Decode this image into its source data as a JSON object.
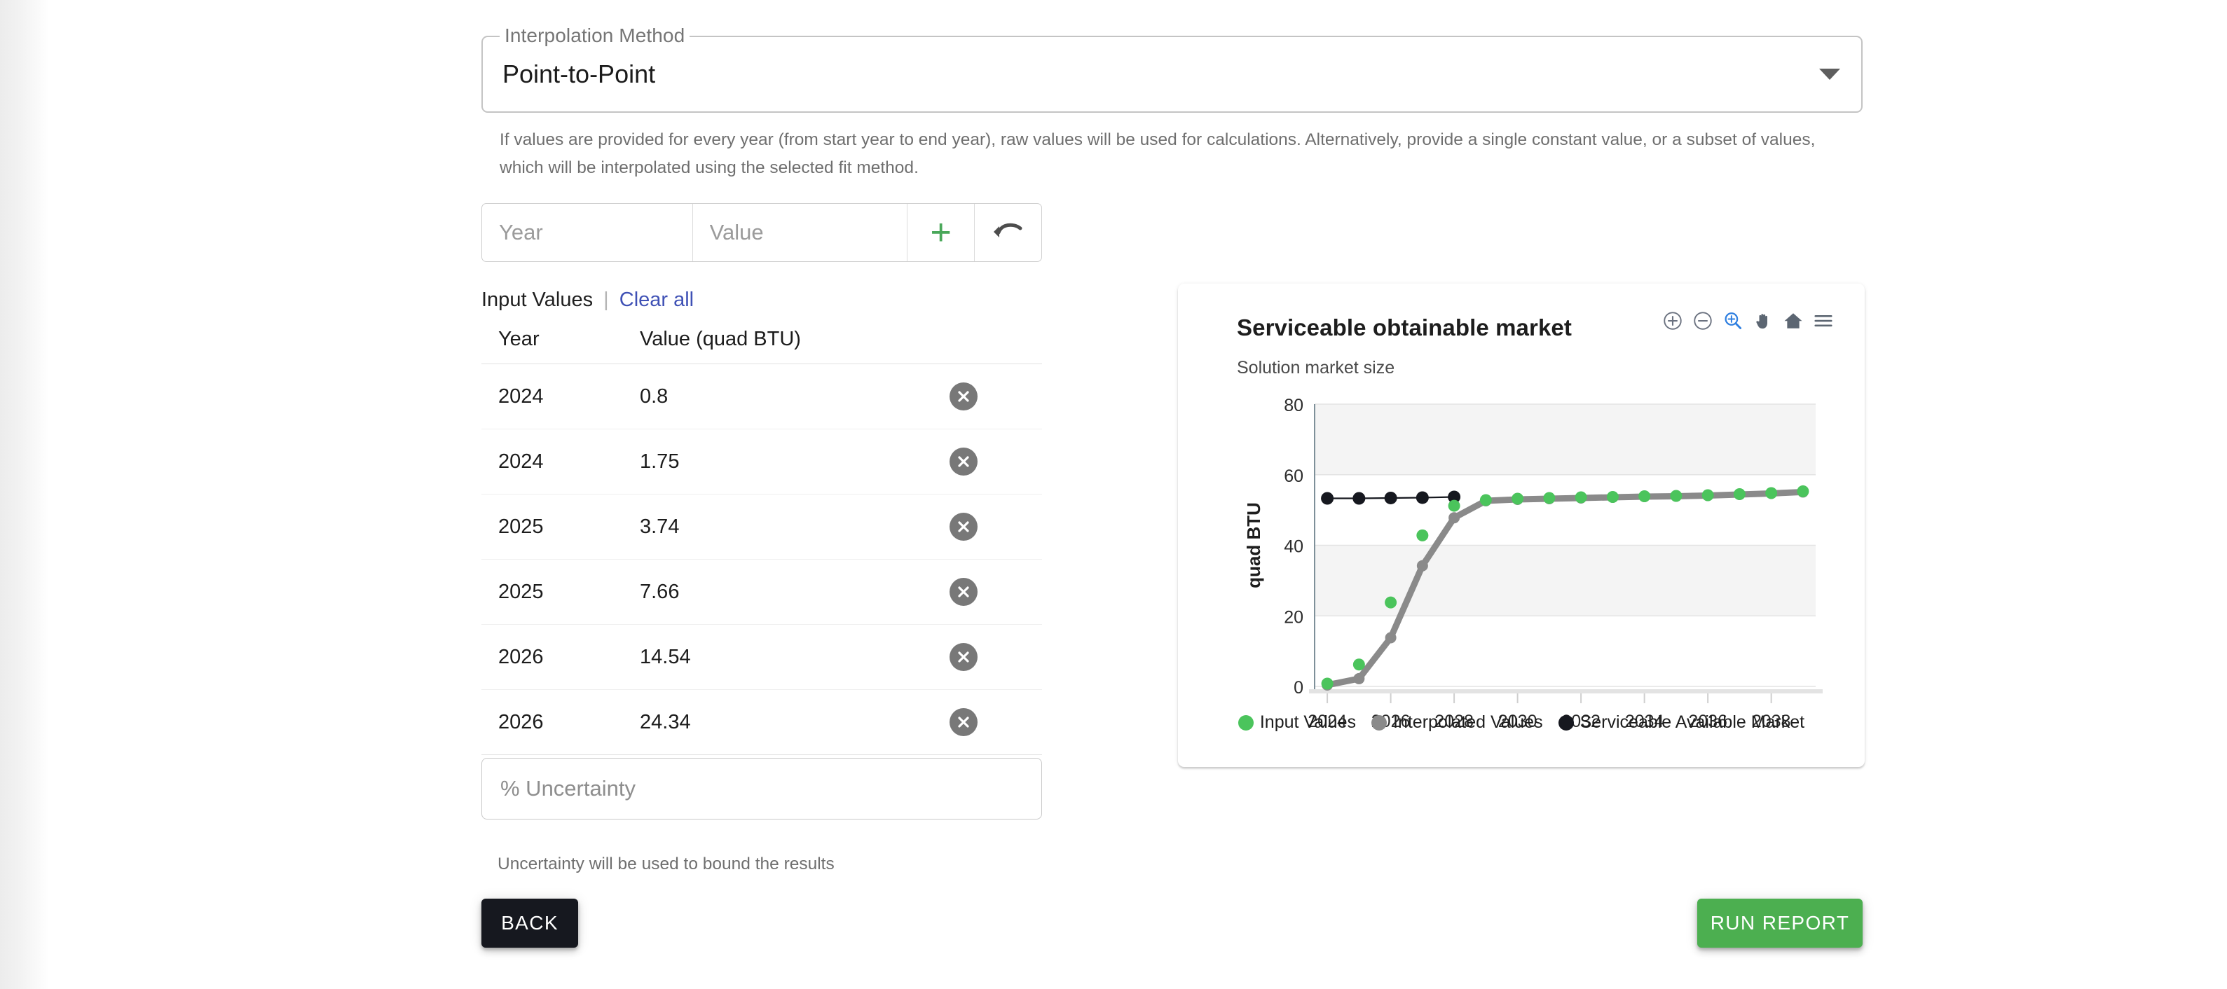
{
  "form": {
    "interpolation": {
      "legend": "Interpolation Method",
      "value": "Point-to-Point",
      "caret_icon": "chevron-down-icon"
    },
    "helper_text": "If values are provided for every year (from start year to end year), raw values will be used for calculations. Alternatively, provide a single constant value, or a subset of values, which will be interpolated using the selected fit method.",
    "adder": {
      "year_placeholder": "Year",
      "year_value": "",
      "value_placeholder": "Value",
      "value_value": "",
      "add_icon": "plus-icon",
      "undo_icon": "undo-arrow-icon"
    },
    "input_values_label": "Input Values",
    "separator": "|",
    "clear_all_label": "Clear all",
    "table": {
      "headers": [
        "Year",
        "Value (quad BTU)",
        ""
      ],
      "rows": [
        {
          "year": "2024",
          "value": "0.8",
          "delete_icon": "close-circle-icon"
        },
        {
          "year": "2024",
          "value": "1.75",
          "delete_icon": "close-circle-icon"
        },
        {
          "year": "2025",
          "value": "3.74",
          "delete_icon": "close-circle-icon"
        },
        {
          "year": "2025",
          "value": "7.66",
          "delete_icon": "close-circle-icon"
        },
        {
          "year": "2026",
          "value": "14.54",
          "delete_icon": "close-circle-icon"
        },
        {
          "year": "2026",
          "value": "24.34",
          "delete_icon": "close-circle-icon"
        }
      ]
    },
    "uncertainty": {
      "placeholder": "% Uncertainty",
      "value": "",
      "helper": "Uncertainty will be used to bound the results"
    }
  },
  "actions": {
    "back_label": "BACK",
    "run_report_label": "RUN REPORT"
  },
  "chart_card": {
    "toolbar": [
      {
        "icon": "zoom-in-icon",
        "active": false
      },
      {
        "icon": "zoom-out-icon",
        "active": false
      },
      {
        "icon": "selection-zoom-icon",
        "active": true
      },
      {
        "icon": "pan-hand-icon",
        "active": false
      },
      {
        "icon": "home-reset-icon",
        "active": false
      },
      {
        "icon": "menu-hamburger-icon",
        "active": false
      }
    ]
  },
  "colors": {
    "input_values": "#4bc45c",
    "interpolated_values": "#8a8a8a",
    "serviceable_available_market": "#16181f",
    "run_report": "#4caf50",
    "back": "#16181f",
    "link": "#3f51b5",
    "toolbar_active": "#2f7fe0"
  },
  "chart_data": {
    "type": "scatter",
    "title": "Serviceable obtainable market",
    "subtitle": "Solution market size",
    "xlabel": "",
    "ylabel": "quad BTU",
    "xlim": [
      2023.6,
      2039.4
    ],
    "ylim": [
      0,
      80
    ],
    "yticks": [
      0,
      20,
      40,
      60,
      80
    ],
    "xticks": [
      2024,
      2026,
      2028,
      2030,
      2032,
      2034,
      2036,
      2038
    ],
    "grid": true,
    "legend_position": "bottom",
    "legend": [
      "Input Values",
      "Interpolated Values",
      "Serviceable Available Market"
    ],
    "series": [
      {
        "name": "Input Values",
        "color": "#4bc45c",
        "x": [
          2024,
          2025,
          2026,
          2027,
          2028,
          2029,
          2030,
          2031,
          2032,
          2033,
          2034,
          2035,
          2036,
          2037,
          2038,
          2039
        ],
        "y": [
          0.8,
          6.2,
          23.8,
          42.8,
          51.2,
          52.8,
          53.2,
          53.4,
          53.6,
          53.7,
          53.9,
          54.0,
          54.2,
          54.5,
          54.8,
          55.3
        ]
      },
      {
        "name": "Interpolated Values",
        "color": "#8a8a8a",
        "x": [
          2024,
          2025,
          2026,
          2027,
          2028,
          2029,
          2030,
          2031,
          2032,
          2033,
          2034,
          2035,
          2036,
          2037,
          2038,
          2039
        ],
        "y": [
          0.4,
          2.2,
          13.8,
          34.2,
          47.8,
          52.6,
          53.0,
          53.2,
          53.4,
          53.6,
          53.8,
          53.9,
          54.1,
          54.4,
          54.7,
          55.1
        ]
      },
      {
        "name": "Serviceable Available Market",
        "color": "#16181f",
        "x": [
          2024,
          2025,
          2026,
          2027,
          2028
        ],
        "y": [
          53.3,
          53.3,
          53.4,
          53.5,
          53.7
        ]
      }
    ]
  }
}
